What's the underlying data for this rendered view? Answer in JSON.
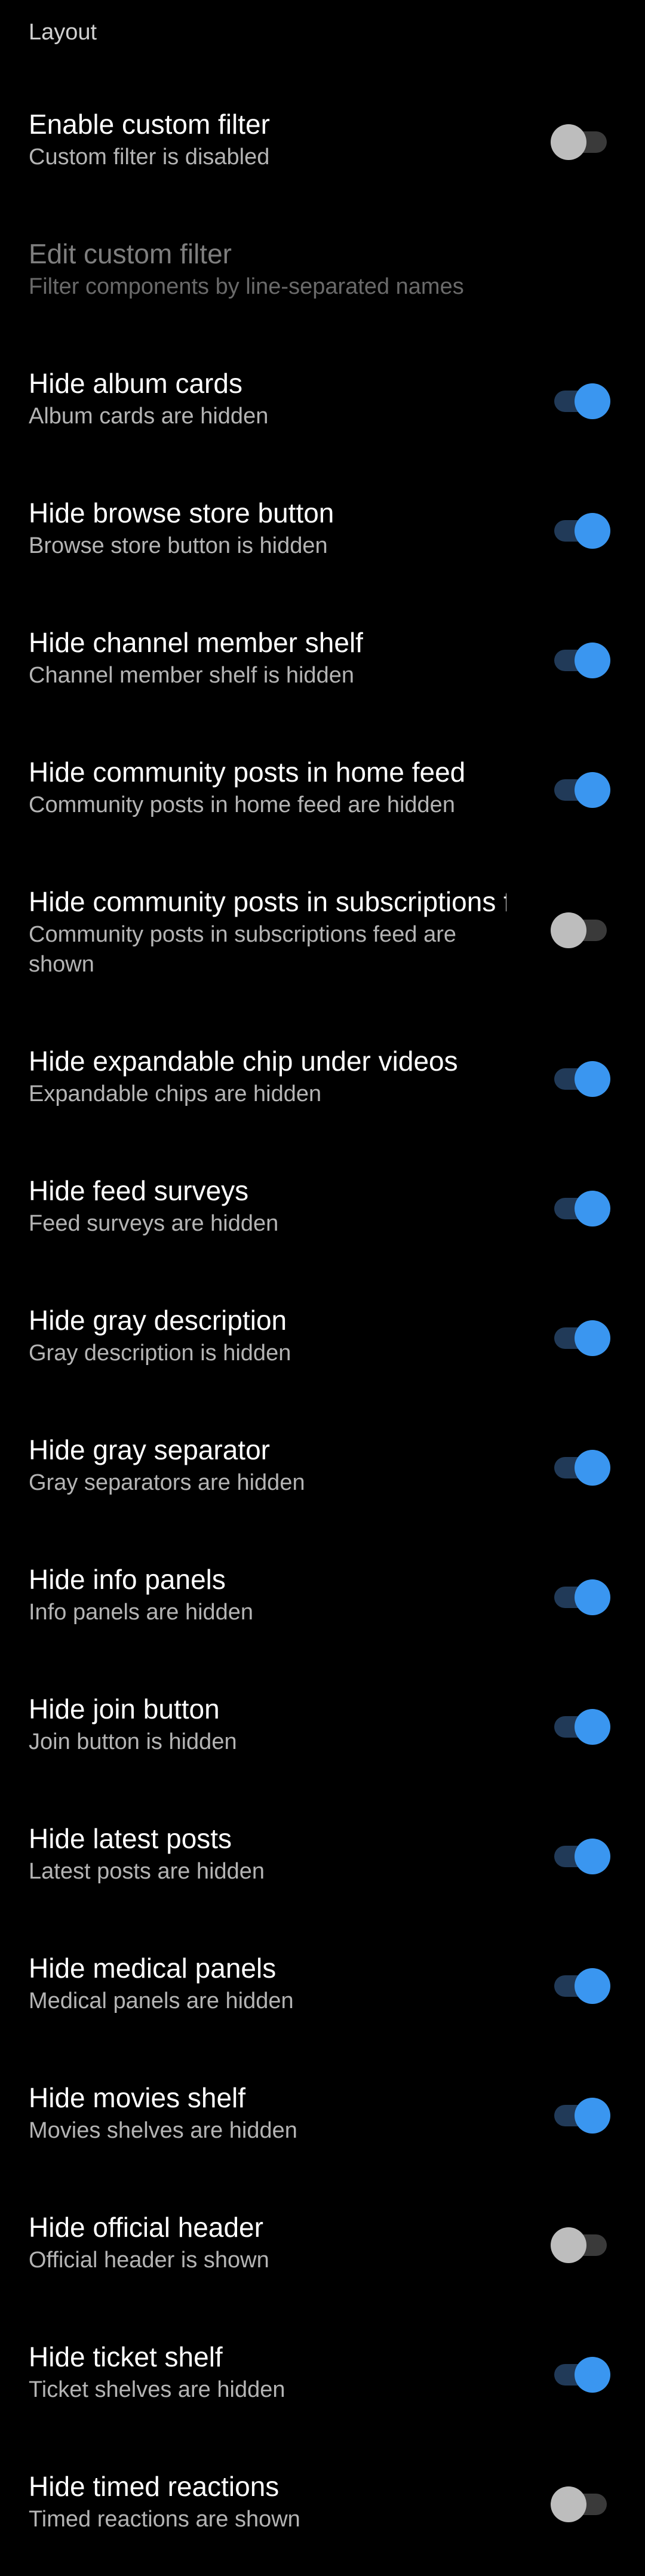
{
  "section": {
    "title": "Layout"
  },
  "colors": {
    "background": "#000000",
    "switch_on_thumb": "#3a96f0",
    "switch_on_track": "#213a58",
    "switch_off_thumb": "#bdbdbd",
    "switch_off_track": "#3a3a3a"
  },
  "items": [
    {
      "title": "Enable custom filter",
      "summary": "Custom filter is disabled",
      "switch": "off"
    },
    {
      "title": "Edit custom filter",
      "summary": "Filter components by line-separated names",
      "enabled": false
    },
    {
      "title": "Hide album cards",
      "summary": "Album cards are hidden",
      "switch": "on"
    },
    {
      "title": "Hide browse store button",
      "summary": "Browse store button is hidden",
      "switch": "on"
    },
    {
      "title": "Hide channel member shelf",
      "summary": "Channel member shelf is hidden",
      "switch": "on"
    },
    {
      "title": "Hide community posts in home feed",
      "summary": "Community posts in home feed are hidden",
      "switch": "on"
    },
    {
      "title": "Hide community posts in subscriptions f..",
      "summary": "Community posts in subscriptions feed are shown",
      "switch": "off"
    },
    {
      "title": "Hide expandable chip under videos",
      "summary": "Expandable chips are hidden",
      "switch": "on"
    },
    {
      "title": "Hide feed surveys",
      "summary": "Feed surveys are hidden",
      "switch": "on"
    },
    {
      "title": "Hide gray description",
      "summary": "Gray description is hidden",
      "switch": "on"
    },
    {
      "title": "Hide gray separator",
      "summary": "Gray separators are hidden",
      "switch": "on"
    },
    {
      "title": "Hide info panels",
      "summary": "Info panels are hidden",
      "switch": "on"
    },
    {
      "title": "Hide join button",
      "summary": "Join button is hidden",
      "switch": "on"
    },
    {
      "title": "Hide latest posts",
      "summary": "Latest posts are hidden",
      "switch": "on"
    },
    {
      "title": "Hide medical panels",
      "summary": "Medical panels are hidden",
      "switch": "on"
    },
    {
      "title": "Hide movies shelf",
      "summary": "Movies shelves are hidden",
      "switch": "on"
    },
    {
      "title": "Hide official header",
      "summary": "Official header is shown",
      "switch": "off"
    },
    {
      "title": "Hide ticket shelf",
      "summary": "Ticket shelves are hidden",
      "switch": "on"
    },
    {
      "title": "Hide timed reactions",
      "summary": "Timed reactions are shown",
      "switch": "off"
    }
  ]
}
